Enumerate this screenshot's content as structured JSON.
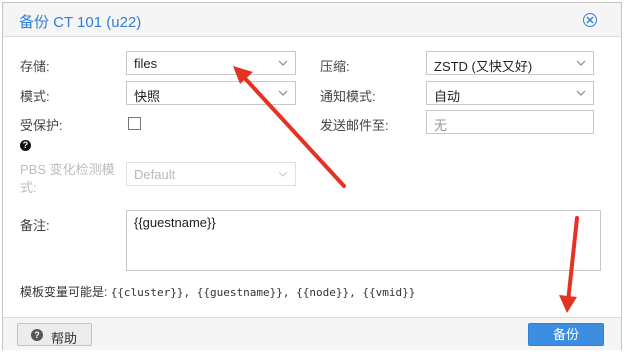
{
  "dialog": {
    "title": "备份 CT 101 (u22)",
    "close_icon": "close-circle-icon"
  },
  "form": {
    "storage": {
      "label": "存储:",
      "value": "files"
    },
    "mode": {
      "label": "模式:",
      "value": "快照"
    },
    "protected": {
      "label": "受保护:",
      "checked": false
    },
    "compression": {
      "label": "压缩:",
      "value": "ZSTD (又快又好)"
    },
    "notify_mode": {
      "label": "通知模式:",
      "value": "自动"
    },
    "send_mail": {
      "label": "发送邮件至:",
      "placeholder": "无"
    },
    "pbs_change": {
      "label_line1": "PBS 变化检测模",
      "label_line2": "式:",
      "value": "Default"
    },
    "notes": {
      "label": "备注:",
      "value": "{{guestname}}"
    },
    "template_vars": {
      "label": "模板变量可能是:",
      "vars": "{{cluster}}, {{guestname}}, {{node}}, {{vmid}}"
    }
  },
  "footer": {
    "help_label": "帮助",
    "backup_label": "备份"
  },
  "colors": {
    "accent": "#2f7fd6",
    "annotation_arrow": "#e53323"
  }
}
